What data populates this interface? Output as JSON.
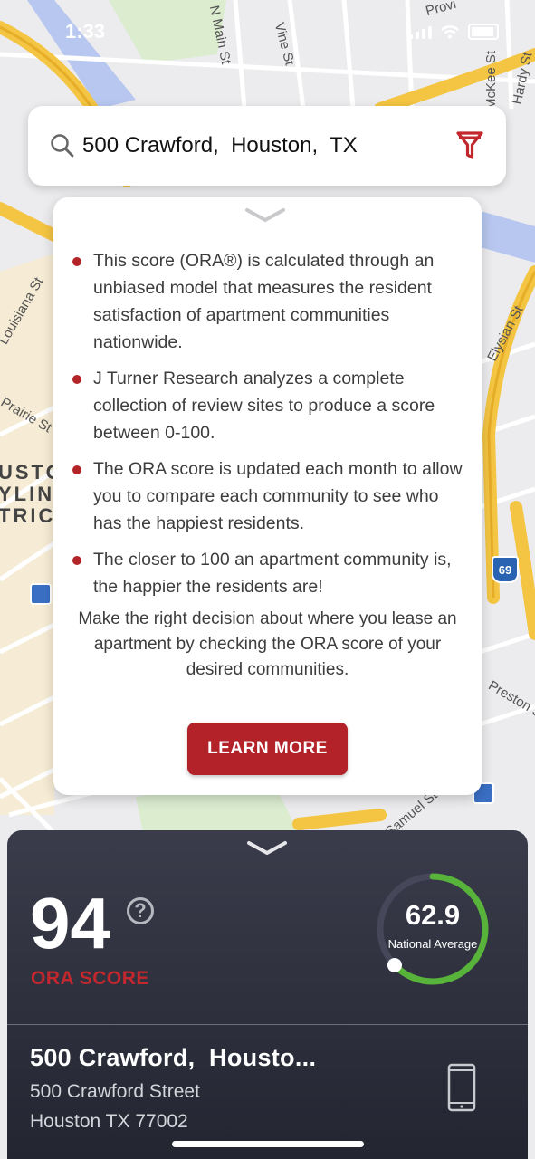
{
  "status_bar": {
    "time": "1:33"
  },
  "map": {
    "street_labels": [
      "N Main St",
      "Vine St",
      "Provi",
      "McKee St",
      "Hardy St",
      "Louisiana St",
      "Elysian St",
      "Prairie St",
      "Preston St",
      "Samuel St"
    ],
    "district_label": [
      "USTO",
      "YLINE",
      "TRIC"
    ],
    "highway_shield": "69"
  },
  "search": {
    "query": "500 Crawford,  Houston,  TX",
    "icon": "search-icon",
    "filter_icon": "filter-icon",
    "accent": "#c1272d"
  },
  "info_card": {
    "bullets": [
      "This score (ORA®) is calculated through an unbiased model that measures the resident satisfaction of apartment communities nationwide.",
      "J Turner Research analyzes a complete collection of review sites to produce a score between 0-100.",
      "The ORA score is updated each month to allow you to compare each community to see who has the happiest residents.",
      "The closer to 100 an apartment community is, the happier the residents are!"
    ],
    "paragraph": "Make the right decision about where you lease an apartment by checking the ORA score of your desired communities.",
    "button_label": "LEARN MORE"
  },
  "score_panel": {
    "score": "94",
    "help_symbol": "?",
    "score_label": "ORA SCORE",
    "national_average": "62.9",
    "national_average_label": "National Average",
    "gauge_color": "#58b33a",
    "address_title": "500 Crawford,  Housto...",
    "address_line1": "500 Crawford Street",
    "address_line2": "Houston TX 77002"
  }
}
